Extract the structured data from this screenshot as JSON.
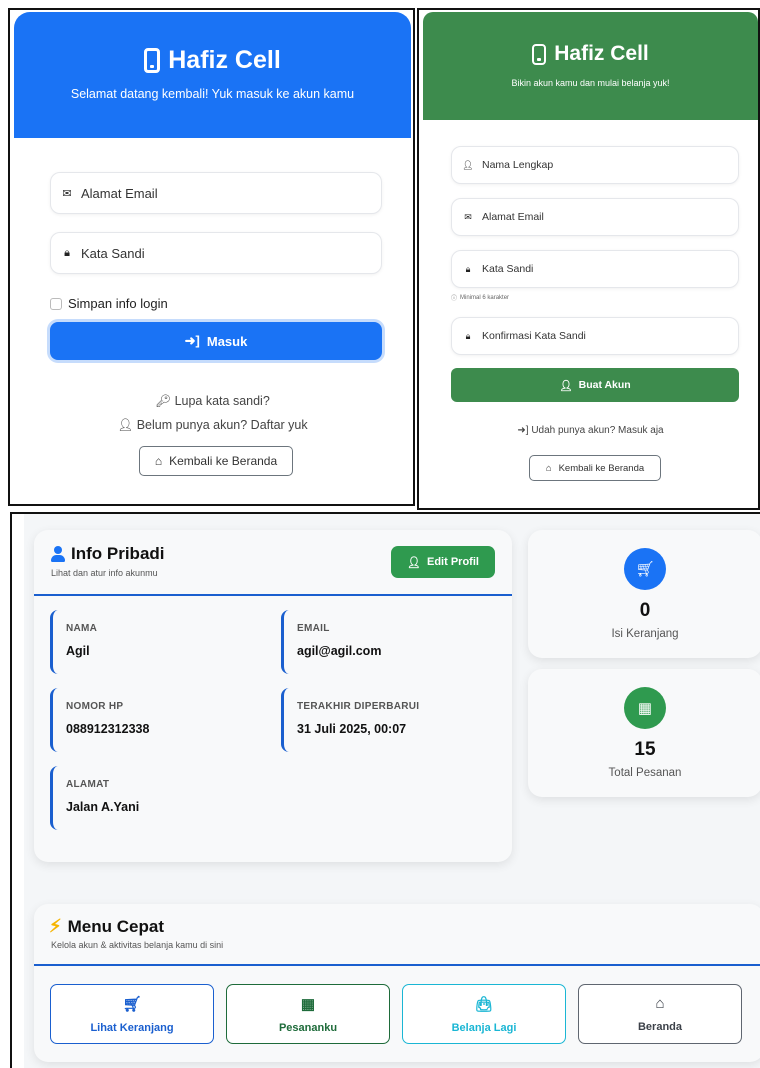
{
  "login": {
    "brand": "Hafiz Cell",
    "subtitle": "Selamat datang kembali! Yuk masuk ke akun kamu",
    "email_placeholder": "Alamat Email",
    "password_placeholder": "Kata Sandi",
    "remember_label": "Simpan info login",
    "submit_label": "Masuk",
    "forgot_label": "Lupa kata sandi?",
    "register_label": "Belum punya akun? Daftar yuk",
    "home_label": "Kembali ke Beranda",
    "accent": "#1a73f5"
  },
  "register": {
    "brand": "Hafiz Cell",
    "subtitle": "Bikin akun kamu dan mulai belanja yuk!",
    "name_placeholder": "Nama Lengkap",
    "email_placeholder": "Alamat Email",
    "password_placeholder": "Kata Sandi",
    "password_hint": "Minimal 6 karakter",
    "confirm_placeholder": "Konfirmasi Kata Sandi",
    "submit_label": "Buat Akun",
    "login_label": "Udah punya akun? Masuk aja",
    "home_label": "Kembali ke Beranda",
    "accent": "#3d8b4d"
  },
  "profile": {
    "title": "Info Pribadi",
    "subtitle": "Lihat dan atur info akunmu",
    "edit_label": "Edit Profil",
    "fields": [
      {
        "label": "NAMA",
        "value": "Agil"
      },
      {
        "label": "EMAIL",
        "value": "agil@agil.com"
      },
      {
        "label": "NOMOR HP",
        "value": "088912312338"
      },
      {
        "label": "TERAKHIR DIPERBARUI",
        "value": "31 Juli 2025, 00:07"
      },
      {
        "label": "ALAMAT",
        "value": "Jalan A.Yani"
      }
    ]
  },
  "stats": [
    {
      "value": "0",
      "label": "Isi Keranjang",
      "icon": "cart-icon",
      "color": "#1a73f5"
    },
    {
      "value": "15",
      "label": "Total Pesanan",
      "icon": "box-icon",
      "color": "#2f9a4f"
    }
  ],
  "menu": {
    "title": "Menu Cepat",
    "subtitle": "Kelola akun & aktivitas belanja kamu di sini",
    "buttons": [
      {
        "label": "Lihat Keranjang",
        "icon": "cart-icon",
        "color": "#1a5fcf"
      },
      {
        "label": "Pesananku",
        "icon": "box-icon",
        "color": "#1e6b3a"
      },
      {
        "label": "Belanja Lagi",
        "icon": "shopping-bag-icon",
        "color": "#1ab6d4"
      },
      {
        "label": "Beranda",
        "icon": "home-icon",
        "color": "#5f6670"
      }
    ]
  }
}
